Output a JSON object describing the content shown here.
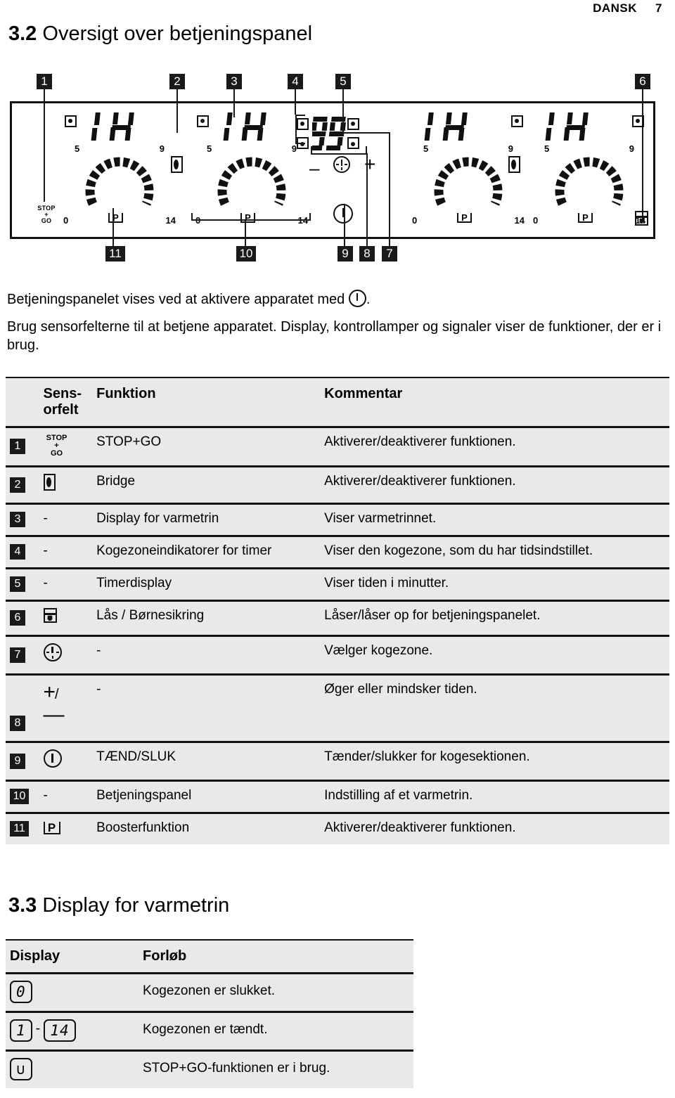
{
  "page": {
    "language_label": "DANSK",
    "page_number": "7"
  },
  "sections": {
    "overview": {
      "number": "3.2",
      "title": "Oversigt over betjeningspanel"
    },
    "display": {
      "number": "3.3",
      "title": "Display for varmetrin"
    }
  },
  "figure": {
    "callouts": [
      "1",
      "2",
      "3",
      "4",
      "5",
      "6",
      "7",
      "8",
      "9",
      "10",
      "11"
    ],
    "zone_displays": [
      "14",
      "14",
      "14",
      "14"
    ],
    "timer_display": "99",
    "scale_labels": {
      "min": "0",
      "mid_low": "5",
      "mid_high": "9",
      "max": "14"
    },
    "booster_label": "P",
    "stopgo_label_lines": [
      "STOP",
      "+",
      "GO"
    ],
    "timer_minus": "–",
    "timer_plus": "+"
  },
  "intro": {
    "line1_before_icon": "Betjeningspanelet vises ved at aktivere apparatet med",
    "line1_after_icon": ".",
    "line2": "Brug sensorfelterne til at betjene apparatet. Display, kontrollamper og signaler viser de funktioner, der er i brug."
  },
  "sensor_table": {
    "headers": {
      "sensor_field": "Sens-\norfelt",
      "sensor_field_line1": "Sens-",
      "sensor_field_line2": "orfelt",
      "function": "Funktion",
      "comment": "Kommentar"
    },
    "rows": [
      {
        "num": "1",
        "icon": "stopgo-icon",
        "function": "STOP+GO",
        "comment": "Aktiverer/deaktiverer funktionen."
      },
      {
        "num": "2",
        "icon": "bridge-icon",
        "function": "Bridge",
        "comment": "Aktiverer/deaktiverer funktionen."
      },
      {
        "num": "3",
        "icon": "-",
        "function": "Display for varmetrin",
        "comment": "Viser varmetrinnet."
      },
      {
        "num": "4",
        "icon": "-",
        "function": "Kogezoneindikatorer for timer",
        "comment": "Viser den kogezone, som du har tidsindstillet."
      },
      {
        "num": "5",
        "icon": "-",
        "function": "Timerdisplay",
        "comment": "Viser tiden i minutter."
      },
      {
        "num": "6",
        "icon": "lock-icon",
        "function": "Lås / Børnesikring",
        "comment": "Låser/låser op for betjeningspanelet."
      },
      {
        "num": "7",
        "icon": "clock-icon",
        "function": "-",
        "comment": "Vælger kogezone."
      },
      {
        "num": "8",
        "icon": "plus-minus-icon",
        "function": "-",
        "comment": "Øger eller mindsker tiden."
      },
      {
        "num": "9",
        "icon": "power-icon",
        "function": "TÆND/SLUK",
        "comment": "Tænder/slukker for kogesektionen."
      },
      {
        "num": "10",
        "icon": "-",
        "function": "Betjeningspanel",
        "comment": "Indstilling af et varmetrin."
      },
      {
        "num": "11",
        "icon": "booster-p-icon",
        "function": "Boosterfunktion",
        "comment": "Aktiverer/deaktiverer funktionen."
      }
    ]
  },
  "display_table": {
    "headers": {
      "display": "Display",
      "progress": "Forløb"
    },
    "rows": [
      {
        "display": "0",
        "display2": "",
        "separator": "",
        "progress": "Kogezonen er slukket."
      },
      {
        "display": "1",
        "display2": "14",
        "separator": "-",
        "progress": "Kogezonen er tændt."
      },
      {
        "display": "∪",
        "display2": "",
        "separator": "",
        "progress": "STOP+GO-funktionen er i brug."
      }
    ]
  },
  "colors": {
    "table_background": "#e8eaea",
    "ink": "#111111",
    "callout_background": "#1a1a1a"
  }
}
